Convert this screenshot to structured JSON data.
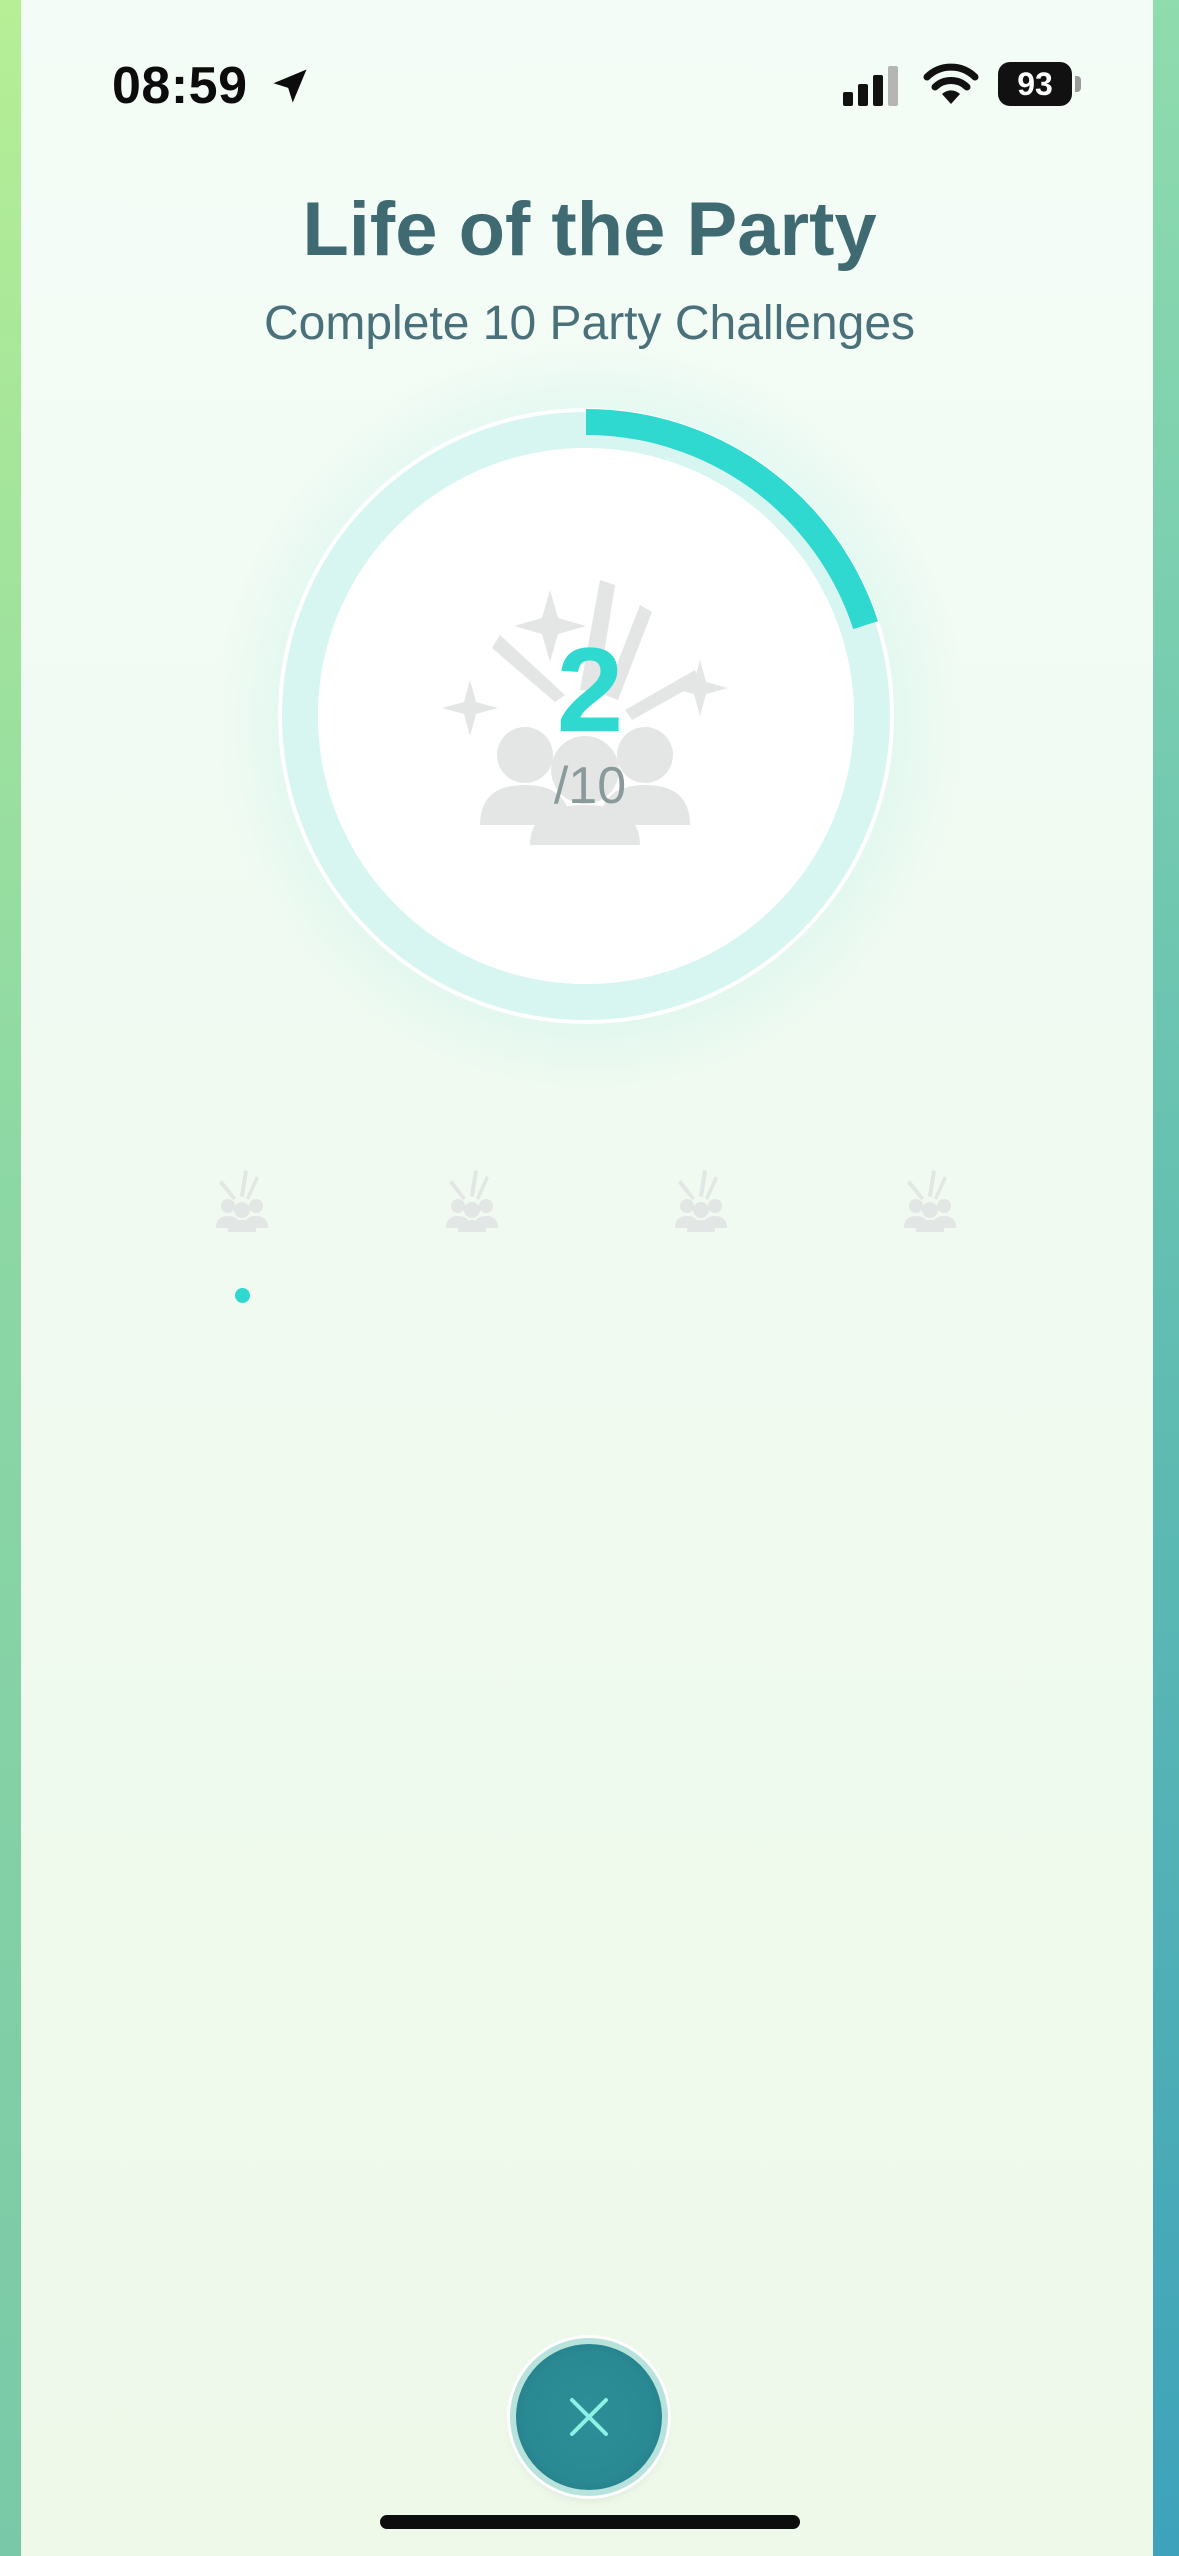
{
  "status_bar": {
    "time": "08:59",
    "battery": "93"
  },
  "medal": {
    "title": "Life of the Party",
    "subtitle": "Complete 10 Party Challenges",
    "current": "2",
    "goal_label": "/10",
    "progress": 0.2
  },
  "tiers": [
    {
      "icon": "party-icon",
      "reached": true
    },
    {
      "icon": "party-icon",
      "reached": false
    },
    {
      "icon": "party-icon",
      "reached": false
    },
    {
      "icon": "party-icon",
      "reached": false
    }
  ],
  "colors": {
    "accent": "#2fd9cf",
    "title": "#3f6a72",
    "close_button": "#2a8a94"
  }
}
